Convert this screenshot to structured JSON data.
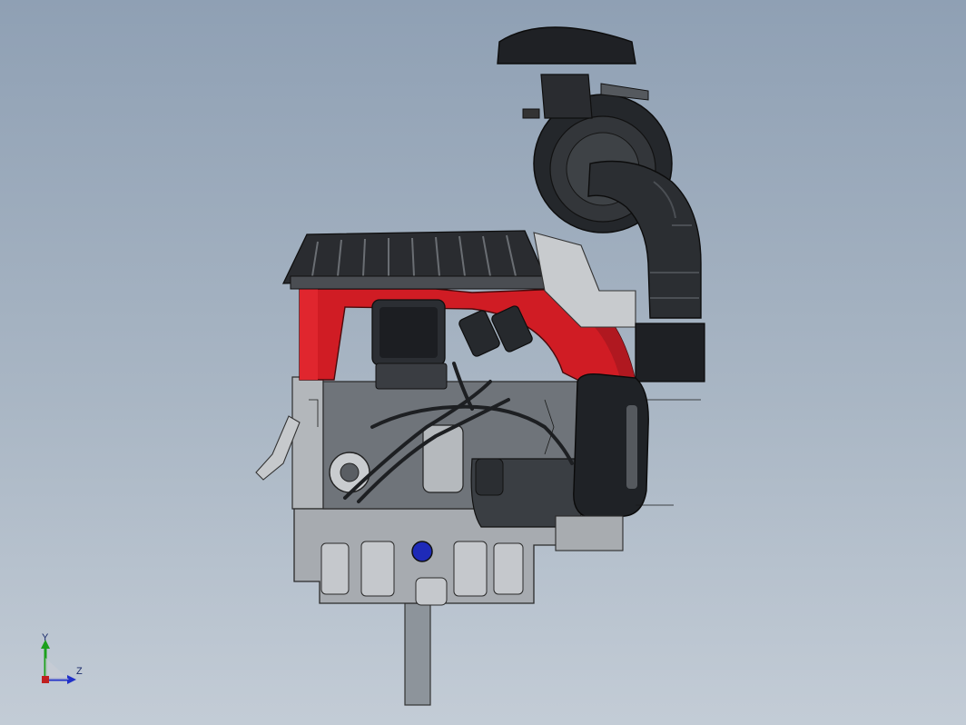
{
  "viewport": {
    "background_top": "#8fa0b4",
    "background_bottom": "#c3ccd6"
  },
  "model": {
    "shroud_color": "#d01c24",
    "cover_color": "#9a9ea4"
  },
  "triad": {
    "y_label": "Y",
    "z_label": "Z",
    "y_color": "#1ca01c",
    "z_color": "#2030c8"
  },
  "icons": [
    "coordinate-triad-icon",
    "engine-model"
  ]
}
